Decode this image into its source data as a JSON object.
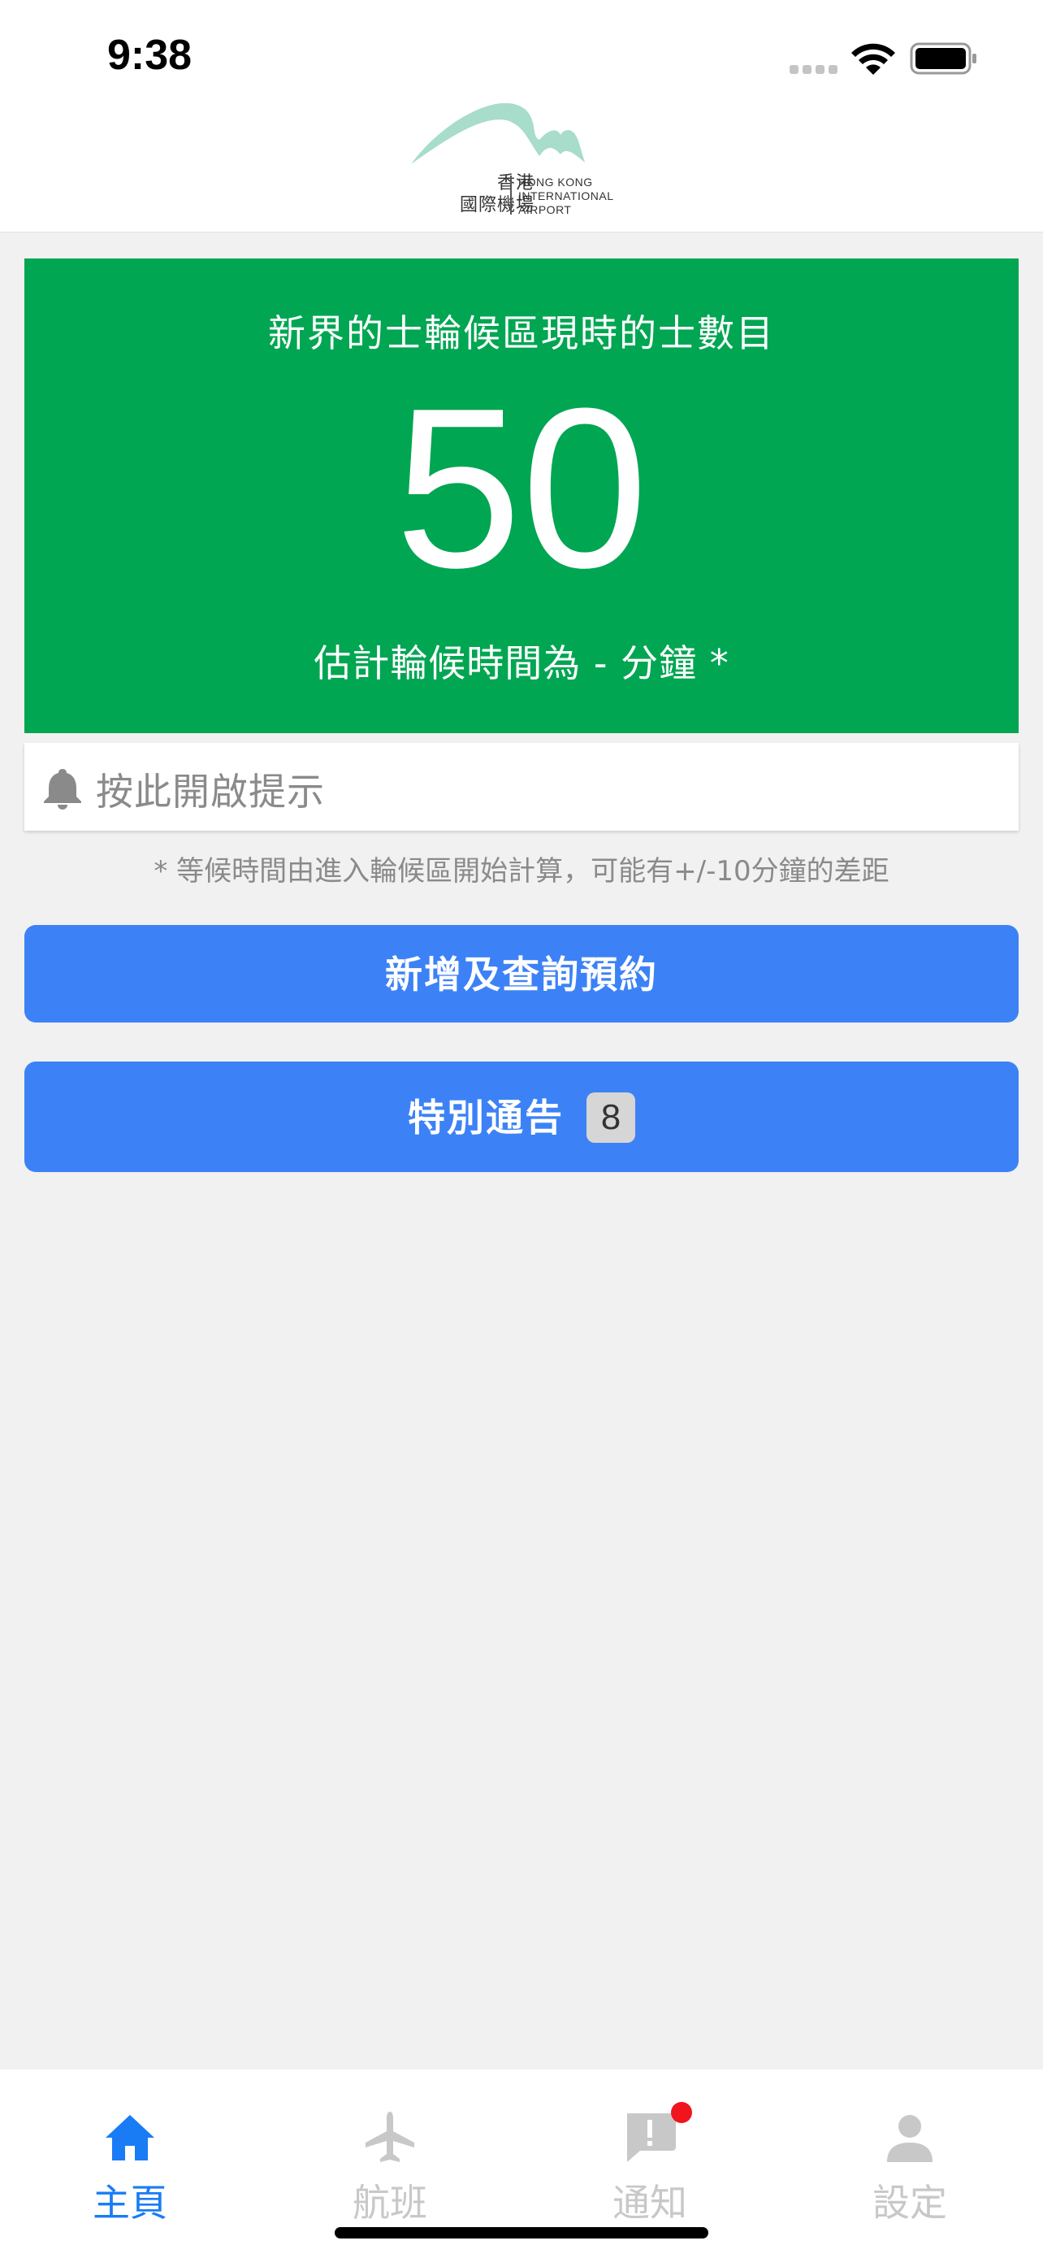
{
  "status_bar": {
    "time": "9:38"
  },
  "header": {
    "logo_cn_line1": "香港",
    "logo_cn_line2": "國際機場",
    "logo_en_line1": "HONG KONG",
    "logo_en_line2": "INTERNATIONAL",
    "logo_en_line3": "AIRPORT",
    "logo_color": "#a8dccb"
  },
  "taxi_card": {
    "title": "新界的士輪候區現時的士數目",
    "count": "50",
    "wait_text": "估計輪候時間為 - 分鐘 *",
    "color": "#00a652"
  },
  "alert": {
    "icon": "bell-icon",
    "label": "按此開啟提示"
  },
  "note": "* 等候時間由進入輪候區開始計算，可能有+/-10分鐘的差距",
  "buttons": {
    "booking_label": "新增及查詢預約",
    "notice_label": "特別通告",
    "notice_badge": "8",
    "color": "#3c82f6"
  },
  "tabs": [
    {
      "label": "主頁",
      "icon": "home-icon",
      "active": true
    },
    {
      "label": "航班",
      "icon": "airplane-icon",
      "active": false
    },
    {
      "label": "通知",
      "icon": "notification-icon",
      "active": false,
      "has_dot": true
    },
    {
      "label": "設定",
      "icon": "person-icon",
      "active": false
    }
  ],
  "accent_color": "#1a7cf5"
}
